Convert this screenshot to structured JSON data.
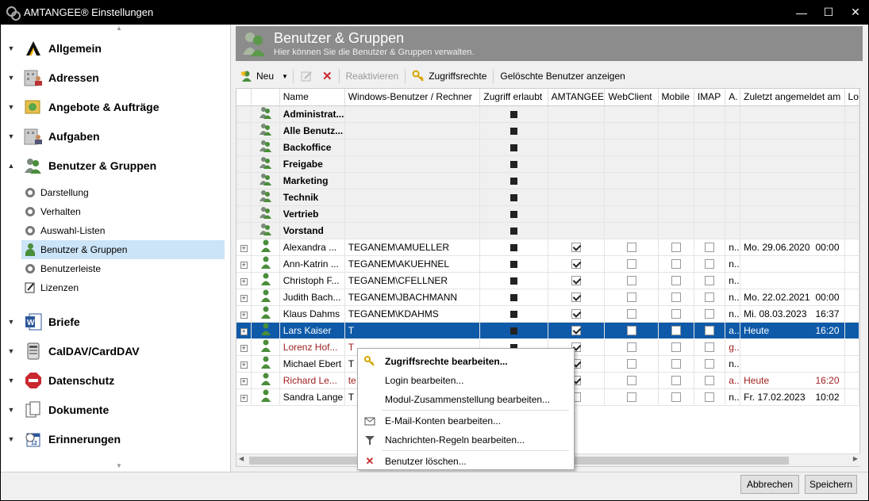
{
  "window": {
    "title": "AMTANGEE® Einstellungen",
    "minimize": "—",
    "maximize": "☐",
    "close": "✕"
  },
  "sidebar": {
    "categories_top": [
      {
        "label": "Allgemein",
        "icon": "allgemein-icon"
      },
      {
        "label": "Adressen",
        "icon": "adressen-icon"
      },
      {
        "label": "Angebote & Aufträge",
        "icon": "angebote-icon"
      },
      {
        "label": "Aufgaben",
        "icon": "aufgaben-icon"
      },
      {
        "label": "Benutzer & Gruppen",
        "icon": "users-icon"
      }
    ],
    "subitems": [
      {
        "label": "Darstellung",
        "icon": "gear-icon"
      },
      {
        "label": "Verhalten",
        "icon": "gear-icon"
      },
      {
        "label": "Auswahl-Listen",
        "icon": "gear-icon"
      },
      {
        "label": "Benutzer & Gruppen",
        "icon": "users-icon"
      },
      {
        "label": "Benutzerleiste",
        "icon": "gear-icon"
      },
      {
        "label": "Lizenzen",
        "icon": "license-icon"
      }
    ],
    "categories_bottom": [
      {
        "label": "Briefe",
        "icon": "word-icon"
      },
      {
        "label": "CalDAV/CardDAV",
        "icon": "caldav-icon"
      },
      {
        "label": "Datenschutz",
        "icon": "stop-icon"
      },
      {
        "label": "Dokumente",
        "icon": "document-icon"
      },
      {
        "label": "Erinnerungen",
        "icon": "calendar-icon"
      }
    ]
  },
  "header": {
    "title": "Benutzer & Gruppen",
    "subtitle": "Hier können Sie die Benutzer & Gruppen verwalten."
  },
  "toolbar": {
    "new": "Neu",
    "reactivate": "Reaktivieren",
    "access": "Zugriffsrechte",
    "show_deleted": "Gelöschte Benutzer anzeigen"
  },
  "grid": {
    "columns": [
      "Name",
      "Windows-Benutzer / Rechner",
      "Zugriff erlaubt",
      "AMTANGEE",
      "WebClient",
      "Mobile",
      "IMAP",
      "A.",
      "Zuletzt angemeldet am",
      "Lo"
    ],
    "groups": [
      "Administrat...",
      "Alle Benutz...",
      "Backoffice",
      "Freigabe",
      "Marketing",
      "Technik",
      "Vertrieb",
      "Vorstand"
    ],
    "users": [
      {
        "name": "Alexandra ...",
        "win": "TEGANEM\\AMUELLER",
        "amt": true,
        "a": "n..",
        "date": "Mo.  29.06.2020",
        "time": "00:00",
        "red": false,
        "sel": false
      },
      {
        "name": "Ann-Katrin ...",
        "win": "TEGANEM\\AKUEHNEL",
        "amt": true,
        "a": "n..",
        "date": "",
        "time": "",
        "red": false,
        "sel": false
      },
      {
        "name": "Christoph F...",
        "win": "TEGANEM\\CFELLNER",
        "amt": true,
        "a": "n..",
        "date": "",
        "time": "",
        "red": false,
        "sel": false
      },
      {
        "name": "Judith Bach...",
        "win": "TEGANEM\\JBACHMANN",
        "amt": true,
        "a": "n..",
        "date": "Mo.  22.02.2021",
        "time": "00:00",
        "red": false,
        "sel": false
      },
      {
        "name": "Klaus Dahms",
        "win": "TEGANEM\\KDAHMS",
        "amt": true,
        "a": "n..",
        "date": "Mi.  08.03.2023",
        "time": "16:37",
        "red": false,
        "sel": false
      },
      {
        "name": "Lars Kaiser",
        "win": "T",
        "amt": true,
        "a": "a..",
        "date": "Heute",
        "time": "16:20",
        "red": false,
        "sel": true
      },
      {
        "name": "Lorenz Hof...",
        "win": "T",
        "amt": true,
        "a": "g..",
        "date": "",
        "time": "",
        "red": true,
        "sel": false
      },
      {
        "name": "Michael Ebert",
        "win": "T",
        "amt": true,
        "a": "n..",
        "date": "",
        "time": "",
        "red": false,
        "sel": false
      },
      {
        "name": "Richard Le...",
        "win": "te",
        "amt": true,
        "a": "a..",
        "date": "Heute",
        "time": "16:20",
        "red": true,
        "sel": false
      },
      {
        "name": "Sandra Lange",
        "win": "T",
        "amt": false,
        "a": "n..",
        "date": "Fr.   17.02.2023",
        "time": "10:02",
        "red": false,
        "sel": false
      }
    ]
  },
  "context_menu": {
    "edit_access": "Zugriffsrechte bearbeiten...",
    "edit_login": "Login bearbeiten...",
    "edit_modules": "Modul-Zusammenstellung bearbeiten...",
    "edit_email": "E-Mail-Konten bearbeiten...",
    "edit_rules": "Nachrichten-Regeln bearbeiten...",
    "delete_user": "Benutzer löschen..."
  },
  "footer": {
    "cancel": "Abbrechen",
    "save": "Speichern"
  },
  "colors": {
    "selection": "#0f5aa8",
    "header_bg": "#8c8c8c",
    "sidebar_selected": "#cce4f7",
    "red_text": "#a02020"
  }
}
